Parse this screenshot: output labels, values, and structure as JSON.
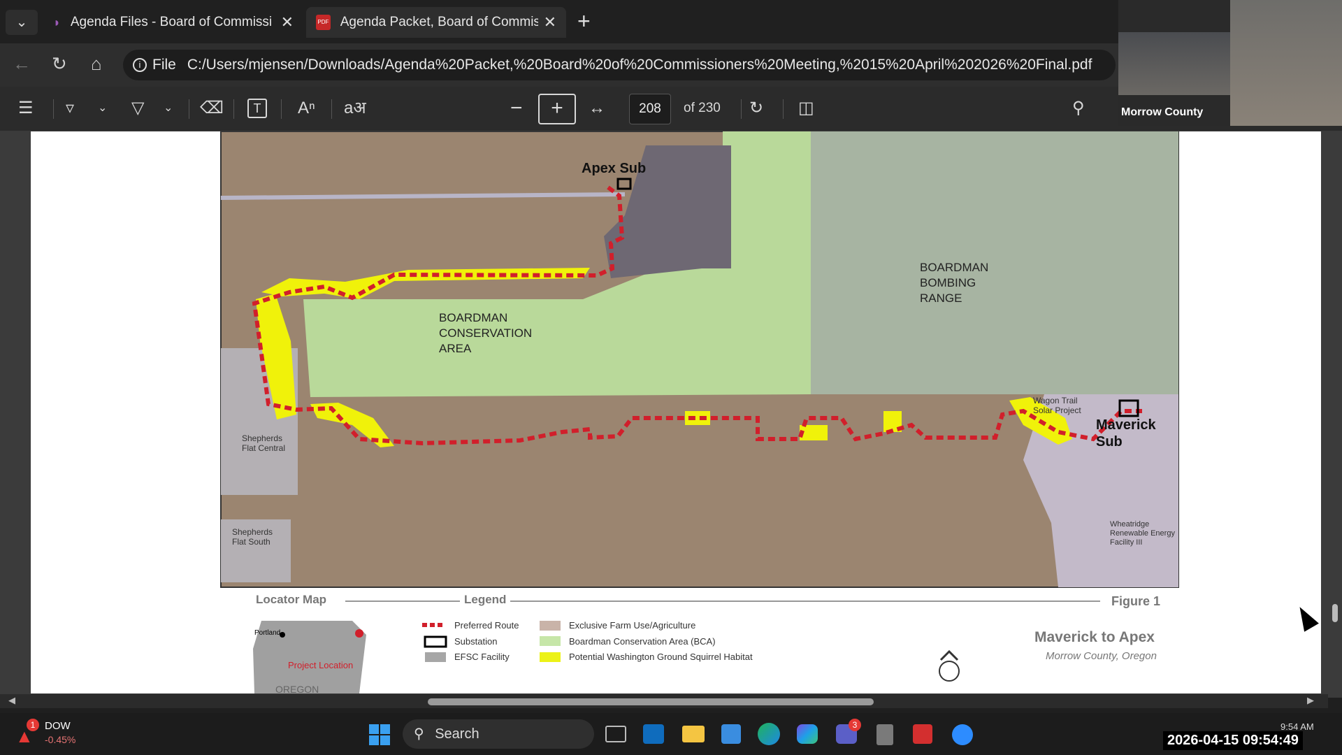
{
  "browser": {
    "tabs": [
      {
        "label": "Agenda Files - Board of Commissi"
      },
      {
        "label": "Agenda Packet, Board of Commiss"
      }
    ],
    "address_prefix": "File",
    "url": "C:/Users/mjensen/Downloads/Agenda%20Packet,%20Board%20of%20Commissioners%20Meeting,%2015%20April%202026%20Final.pdf"
  },
  "pdf_toolbar": {
    "page_current": "208",
    "page_total": "of 230"
  },
  "video_overlay": {
    "caption": "Morrow County"
  },
  "map": {
    "labels": {
      "apex_sub": "Apex Sub",
      "maverick_sub_1": "Maverick",
      "maverick_sub_2": "Sub",
      "bca_1": "BOARDMAN",
      "bca_2": "CONSERVATION",
      "bca_3": "AREA",
      "range_1": "BOARDMAN",
      "range_2": "BOMBING",
      "range_3": "RANGE",
      "shepherds_central_1": "Shepherds",
      "shepherds_central_2": "Flat Central",
      "shepherds_south_1": "Shepherds",
      "shepherds_south_2": "Flat South",
      "wagon_trail_1": "Wagon Trail",
      "wagon_trail_2": "Solar Project",
      "wheatridge_1": "Wheatridge",
      "wheatridge_2": "Renewable Energy",
      "wheatridge_3": "Facility III"
    }
  },
  "map_footer": {
    "locator_title": "Locator Map",
    "legend_title": "Legend",
    "figure_label": "Figure 1",
    "locator_city": "Portland",
    "locator_state": "OREGON",
    "project_location": "Project Location",
    "legend_items": [
      {
        "label": "Preferred Route",
        "color": "#cc1f2d"
      },
      {
        "label": "Substation",
        "color": "#000000"
      },
      {
        "label": "EFSC Facility",
        "color": "#a6a6a6"
      },
      {
        "label": "Exclusive Farm Use/Agriculture",
        "color": "#c9b3a8"
      },
      {
        "label": "Boardman Conservation Area (BCA)",
        "color": "#c6e6a8"
      },
      {
        "label": "Potential Washington Ground Squirrel Habitat",
        "color": "#ecf217"
      }
    ],
    "project_title": "Maverick to Apex",
    "project_subtitle": "Morrow County, Oregon"
  },
  "taskbar": {
    "ticker_name": "DOW",
    "ticker_change": "-0.45%",
    "ticker_badge": "1",
    "search_label": "Search",
    "teams_badge": "3",
    "clock_time": "9:54 AM",
    "timestamp": "2026-04-15 09:54:49"
  },
  "colors": {
    "route": "#d11f2b",
    "habitat": "#f0f20a",
    "conservation": "#b9d99a",
    "farmland": "#9b8570",
    "range": "#a6b2a0"
  }
}
